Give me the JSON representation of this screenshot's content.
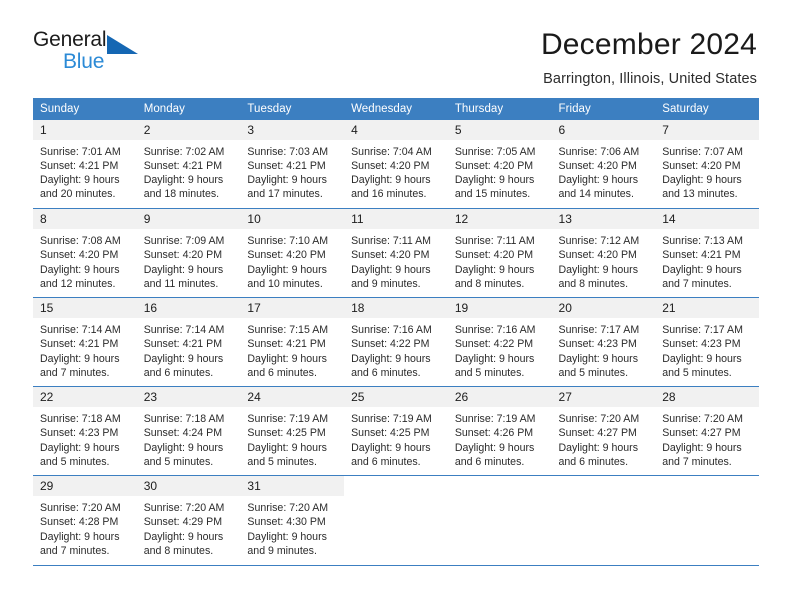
{
  "brand": {
    "name_top": "General",
    "name_bottom": "Blue",
    "triangle_color": "#1567b3",
    "blue_text_color": "#2b8ad6"
  },
  "header": {
    "title": "December 2024",
    "subtitle": "Barrington, Illinois, United States"
  },
  "theme": {
    "header_row_bg": "#3c7fc1",
    "daynum_bg": "#f1f1f1",
    "grid_line": "#3c7fc1"
  },
  "weekday_headers": [
    "Sunday",
    "Monday",
    "Tuesday",
    "Wednesday",
    "Thursday",
    "Friday",
    "Saturday"
  ],
  "weeks": [
    [
      {
        "day": "1",
        "sunrise": "Sunrise: 7:01 AM",
        "sunset": "Sunset: 4:21 PM",
        "daylight_line1": "Daylight: 9 hours",
        "daylight_line2": "and 20 minutes."
      },
      {
        "day": "2",
        "sunrise": "Sunrise: 7:02 AM",
        "sunset": "Sunset: 4:21 PM",
        "daylight_line1": "Daylight: 9 hours",
        "daylight_line2": "and 18 minutes."
      },
      {
        "day": "3",
        "sunrise": "Sunrise: 7:03 AM",
        "sunset": "Sunset: 4:21 PM",
        "daylight_line1": "Daylight: 9 hours",
        "daylight_line2": "and 17 minutes."
      },
      {
        "day": "4",
        "sunrise": "Sunrise: 7:04 AM",
        "sunset": "Sunset: 4:20 PM",
        "daylight_line1": "Daylight: 9 hours",
        "daylight_line2": "and 16 minutes."
      },
      {
        "day": "5",
        "sunrise": "Sunrise: 7:05 AM",
        "sunset": "Sunset: 4:20 PM",
        "daylight_line1": "Daylight: 9 hours",
        "daylight_line2": "and 15 minutes."
      },
      {
        "day": "6",
        "sunrise": "Sunrise: 7:06 AM",
        "sunset": "Sunset: 4:20 PM",
        "daylight_line1": "Daylight: 9 hours",
        "daylight_line2": "and 14 minutes."
      },
      {
        "day": "7",
        "sunrise": "Sunrise: 7:07 AM",
        "sunset": "Sunset: 4:20 PM",
        "daylight_line1": "Daylight: 9 hours",
        "daylight_line2": "and 13 minutes."
      }
    ],
    [
      {
        "day": "8",
        "sunrise": "Sunrise: 7:08 AM",
        "sunset": "Sunset: 4:20 PM",
        "daylight_line1": "Daylight: 9 hours",
        "daylight_line2": "and 12 minutes."
      },
      {
        "day": "9",
        "sunrise": "Sunrise: 7:09 AM",
        "sunset": "Sunset: 4:20 PM",
        "daylight_line1": "Daylight: 9 hours",
        "daylight_line2": "and 11 minutes."
      },
      {
        "day": "10",
        "sunrise": "Sunrise: 7:10 AM",
        "sunset": "Sunset: 4:20 PM",
        "daylight_line1": "Daylight: 9 hours",
        "daylight_line2": "and 10 minutes."
      },
      {
        "day": "11",
        "sunrise": "Sunrise: 7:11 AM",
        "sunset": "Sunset: 4:20 PM",
        "daylight_line1": "Daylight: 9 hours",
        "daylight_line2": "and 9 minutes."
      },
      {
        "day": "12",
        "sunrise": "Sunrise: 7:11 AM",
        "sunset": "Sunset: 4:20 PM",
        "daylight_line1": "Daylight: 9 hours",
        "daylight_line2": "and 8 minutes."
      },
      {
        "day": "13",
        "sunrise": "Sunrise: 7:12 AM",
        "sunset": "Sunset: 4:20 PM",
        "daylight_line1": "Daylight: 9 hours",
        "daylight_line2": "and 8 minutes."
      },
      {
        "day": "14",
        "sunrise": "Sunrise: 7:13 AM",
        "sunset": "Sunset: 4:21 PM",
        "daylight_line1": "Daylight: 9 hours",
        "daylight_line2": "and 7 minutes."
      }
    ],
    [
      {
        "day": "15",
        "sunrise": "Sunrise: 7:14 AM",
        "sunset": "Sunset: 4:21 PM",
        "daylight_line1": "Daylight: 9 hours",
        "daylight_line2": "and 7 minutes."
      },
      {
        "day": "16",
        "sunrise": "Sunrise: 7:14 AM",
        "sunset": "Sunset: 4:21 PM",
        "daylight_line1": "Daylight: 9 hours",
        "daylight_line2": "and 6 minutes."
      },
      {
        "day": "17",
        "sunrise": "Sunrise: 7:15 AM",
        "sunset": "Sunset: 4:21 PM",
        "daylight_line1": "Daylight: 9 hours",
        "daylight_line2": "and 6 minutes."
      },
      {
        "day": "18",
        "sunrise": "Sunrise: 7:16 AM",
        "sunset": "Sunset: 4:22 PM",
        "daylight_line1": "Daylight: 9 hours",
        "daylight_line2": "and 6 minutes."
      },
      {
        "day": "19",
        "sunrise": "Sunrise: 7:16 AM",
        "sunset": "Sunset: 4:22 PM",
        "daylight_line1": "Daylight: 9 hours",
        "daylight_line2": "and 5 minutes."
      },
      {
        "day": "20",
        "sunrise": "Sunrise: 7:17 AM",
        "sunset": "Sunset: 4:23 PM",
        "daylight_line1": "Daylight: 9 hours",
        "daylight_line2": "and 5 minutes."
      },
      {
        "day": "21",
        "sunrise": "Sunrise: 7:17 AM",
        "sunset": "Sunset: 4:23 PM",
        "daylight_line1": "Daylight: 9 hours",
        "daylight_line2": "and 5 minutes."
      }
    ],
    [
      {
        "day": "22",
        "sunrise": "Sunrise: 7:18 AM",
        "sunset": "Sunset: 4:23 PM",
        "daylight_line1": "Daylight: 9 hours",
        "daylight_line2": "and 5 minutes."
      },
      {
        "day": "23",
        "sunrise": "Sunrise: 7:18 AM",
        "sunset": "Sunset: 4:24 PM",
        "daylight_line1": "Daylight: 9 hours",
        "daylight_line2": "and 5 minutes."
      },
      {
        "day": "24",
        "sunrise": "Sunrise: 7:19 AM",
        "sunset": "Sunset: 4:25 PM",
        "daylight_line1": "Daylight: 9 hours",
        "daylight_line2": "and 5 minutes."
      },
      {
        "day": "25",
        "sunrise": "Sunrise: 7:19 AM",
        "sunset": "Sunset: 4:25 PM",
        "daylight_line1": "Daylight: 9 hours",
        "daylight_line2": "and 6 minutes."
      },
      {
        "day": "26",
        "sunrise": "Sunrise: 7:19 AM",
        "sunset": "Sunset: 4:26 PM",
        "daylight_line1": "Daylight: 9 hours",
        "daylight_line2": "and 6 minutes."
      },
      {
        "day": "27",
        "sunrise": "Sunrise: 7:20 AM",
        "sunset": "Sunset: 4:27 PM",
        "daylight_line1": "Daylight: 9 hours",
        "daylight_line2": "and 6 minutes."
      },
      {
        "day": "28",
        "sunrise": "Sunrise: 7:20 AM",
        "sunset": "Sunset: 4:27 PM",
        "daylight_line1": "Daylight: 9 hours",
        "daylight_line2": "and 7 minutes."
      }
    ],
    [
      {
        "day": "29",
        "sunrise": "Sunrise: 7:20 AM",
        "sunset": "Sunset: 4:28 PM",
        "daylight_line1": "Daylight: 9 hours",
        "daylight_line2": "and 7 minutes."
      },
      {
        "day": "30",
        "sunrise": "Sunrise: 7:20 AM",
        "sunset": "Sunset: 4:29 PM",
        "daylight_line1": "Daylight: 9 hours",
        "daylight_line2": "and 8 minutes."
      },
      {
        "day": "31",
        "sunrise": "Sunrise: 7:20 AM",
        "sunset": "Sunset: 4:30 PM",
        "daylight_line1": "Daylight: 9 hours",
        "daylight_line2": "and 9 minutes."
      },
      {
        "day": "",
        "sunrise": "",
        "sunset": "",
        "daylight_line1": "",
        "daylight_line2": ""
      },
      {
        "day": "",
        "sunrise": "",
        "sunset": "",
        "daylight_line1": "",
        "daylight_line2": ""
      },
      {
        "day": "",
        "sunrise": "",
        "sunset": "",
        "daylight_line1": "",
        "daylight_line2": ""
      },
      {
        "day": "",
        "sunrise": "",
        "sunset": "",
        "daylight_line1": "",
        "daylight_line2": ""
      }
    ]
  ]
}
